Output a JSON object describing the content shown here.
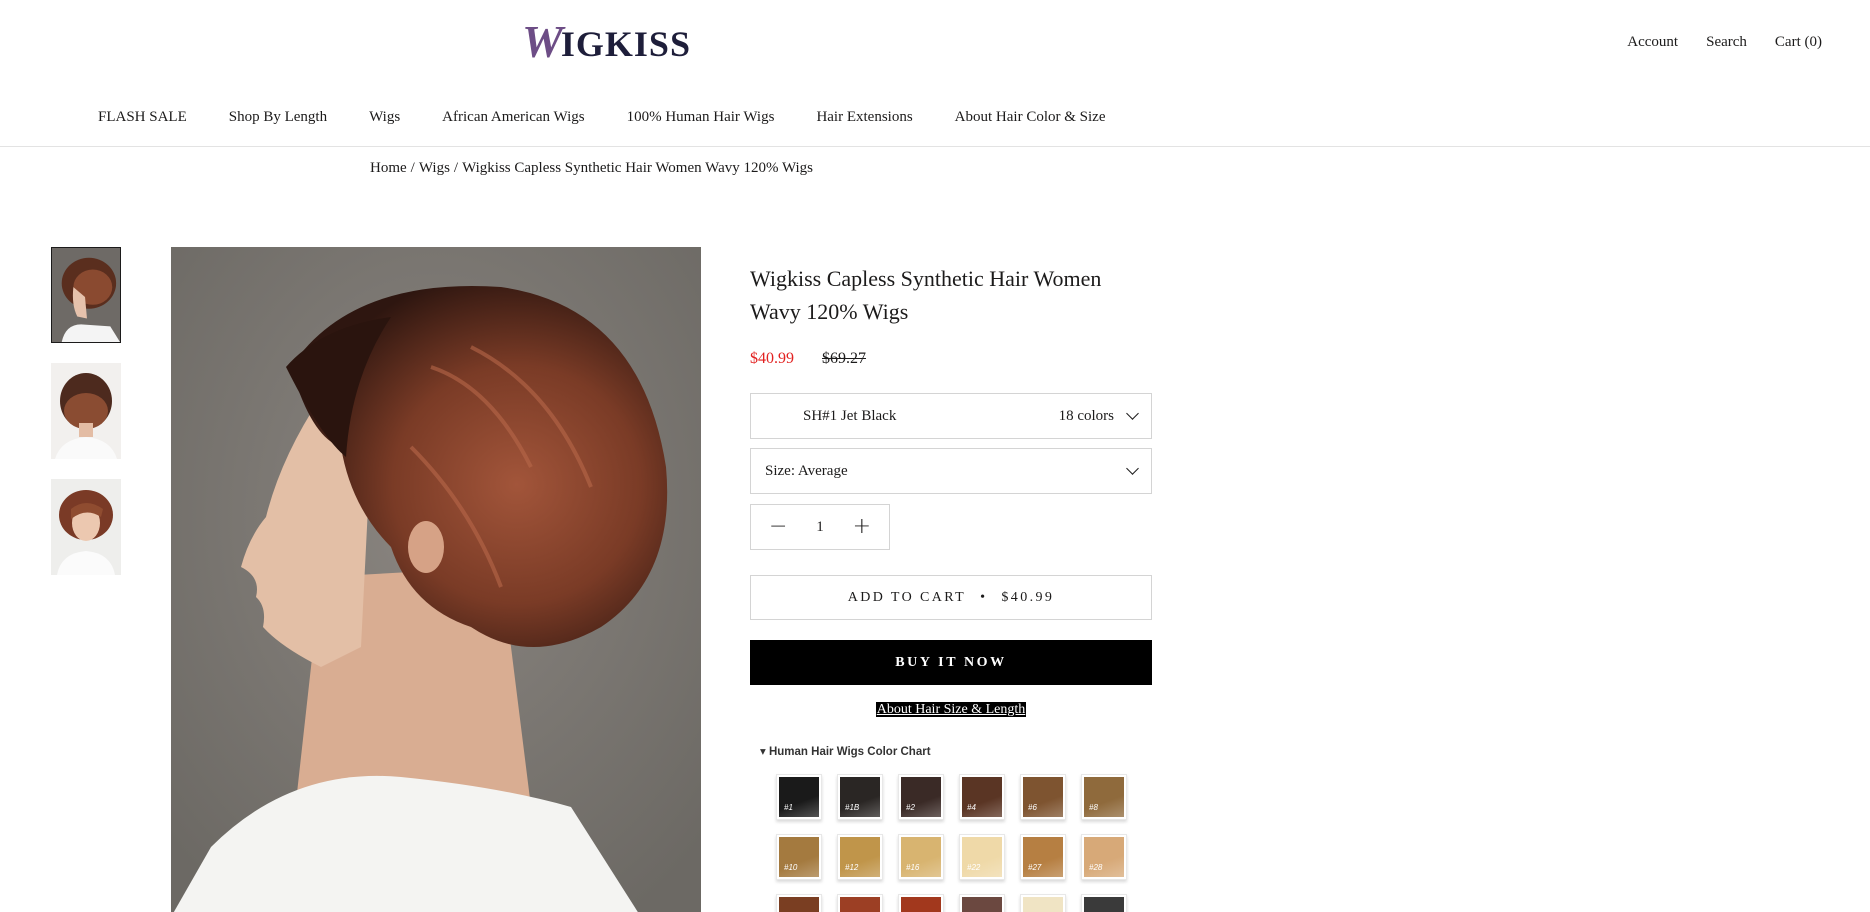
{
  "brand": {
    "logo_initial": "W",
    "logo_rest": "IGKISS"
  },
  "header": {
    "account": "Account",
    "search": "Search",
    "cart": "Cart (0)"
  },
  "nav": [
    "FLASH SALE",
    "Shop By Length",
    "Wigs",
    "African American Wigs",
    "100% Human Hair Wigs",
    "Hair Extensions",
    "About Hair Color & Size"
  ],
  "breadcrumb": {
    "home": "Home",
    "sep": "/",
    "wigs": "Wigs",
    "current": "Wigkiss Capless Synthetic Hair Women Wavy 120% Wigs"
  },
  "product": {
    "title_line1": "Wigkiss Capless Synthetic Hair Women",
    "title_line2": "Wavy 120% Wigs",
    "price_sale": "$40.99",
    "price_old": "$69.27",
    "color_value": "SH#1 Jet Black",
    "color_count": "18 colors",
    "size_label": "Size: Average",
    "quantity": "1",
    "add_to_cart": "ADD TO CART",
    "add_to_cart_sep": "•",
    "add_to_cart_price": "$40.99",
    "buy_now": "BUY IT NOW",
    "about_link": "About Hair Size & Length"
  },
  "color_chart": {
    "title": "▾ Human Hair Wigs Color Chart",
    "swatches": [
      {
        "label": "#1",
        "color": "#1a1a1a"
      },
      {
        "label": "#1B",
        "color": "#2a2624"
      },
      {
        "label": "#2",
        "color": "#3a2a26"
      },
      {
        "label": "#4",
        "color": "#5a3524"
      },
      {
        "label": "#6",
        "color": "#7e5430"
      },
      {
        "label": "#8",
        "color": "#8f6a3c"
      },
      {
        "label": "#10",
        "color": "#a47a3f"
      },
      {
        "label": "#12",
        "color": "#c0954a"
      },
      {
        "label": "#16",
        "color": "#d8b470"
      },
      {
        "label": "#22",
        "color": "#efd9a8"
      },
      {
        "label": "#27",
        "color": "#b67f42"
      },
      {
        "label": "#28",
        "color": "#d7a978"
      },
      {
        "label": "",
        "color": "#7a3e22"
      },
      {
        "label": "",
        "color": "#9c3f24"
      },
      {
        "label": "",
        "color": "#a2381d"
      },
      {
        "label": "",
        "color": "#6b4840"
      },
      {
        "label": "",
        "color": "#f0e4c4"
      },
      {
        "label": "",
        "color": "#3a3a3a"
      }
    ]
  },
  "icons": {
    "minus": "minus-icon",
    "plus": "plus-icon",
    "chevron": "chevron-down-icon"
  }
}
